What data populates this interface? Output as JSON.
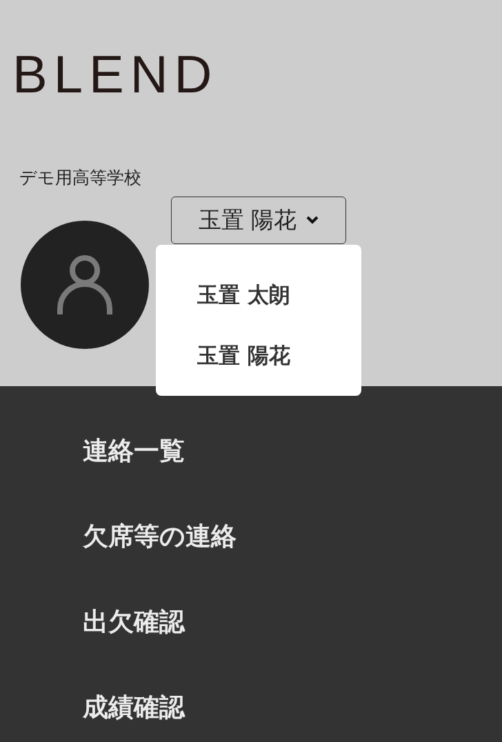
{
  "logo": "BLEND",
  "school": "デモ用高等学校",
  "user_select": {
    "value": "玉置 陽花",
    "expanded": true
  },
  "user_menu": [
    {
      "label": "玉置 太朗"
    },
    {
      "label": "玉置 陽花"
    }
  ],
  "nav_items": [
    {
      "label": "連絡一覧"
    },
    {
      "label": "欠席等の連絡"
    },
    {
      "label": "出欠確認"
    },
    {
      "label": "成績確認"
    }
  ]
}
